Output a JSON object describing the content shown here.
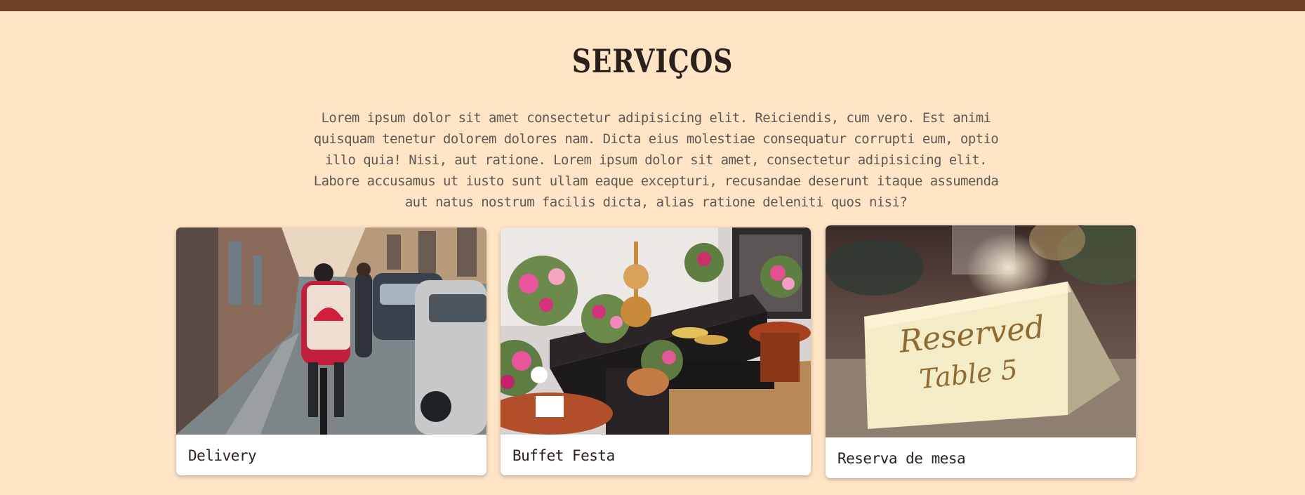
{
  "header": {
    "bar_color": "#6f3f2a"
  },
  "section": {
    "title": "SERVIÇOS",
    "description": "Lorem ipsum dolor sit amet consectetur adipisicing elit. Reiciendis, cum vero. Est animi quisquam tenetur dolorem dolores nam. Dicta eius molestiae consequatur corrupti eum, optio illo quia! Nisi, aut ratione. Lorem ipsum dolor sit amet, consectetur adipisicing elit. Labore accusamus ut iusto sunt ullam eaque excepturi, recusandae deserunt itaque assumenda aut natus nostrum facilis dicta, alias ratione deleniti quos nisi?"
  },
  "cards": [
    {
      "label": "Delivery",
      "image": "delivery-cyclist-photo"
    },
    {
      "label": "Buffet Festa",
      "image": "buffet-table-photo"
    },
    {
      "label": "Reserva de mesa",
      "image": "reserved-table-card-photo",
      "card_text_line1": "Reserved",
      "card_text_line2": "Table 5"
    }
  ],
  "colors": {
    "background": "#ffe4c6",
    "text": "#2b211c",
    "muted_text": "#5f5953"
  }
}
